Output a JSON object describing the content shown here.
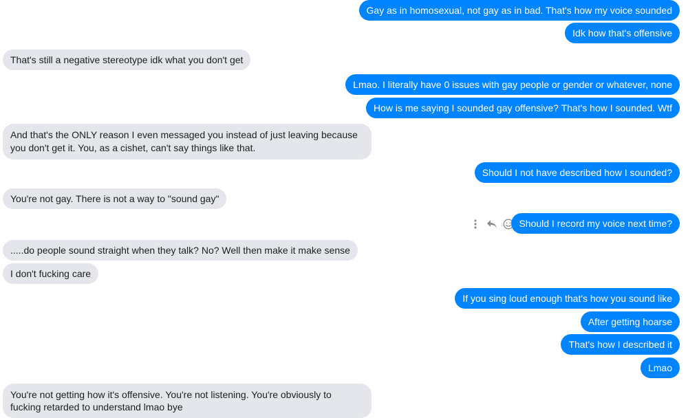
{
  "messages": [
    {
      "dir": "out",
      "text": "Gay as in homosexual, not gay as in bad. That's how my voice sounded"
    },
    {
      "dir": "out",
      "text": "Idk how that's offensive"
    },
    {
      "dir": "in",
      "text": "That's still a negative stereotype idk what you don't get"
    },
    {
      "dir": "out",
      "text": "Lmao. I literally have 0 issues with gay people or gender or whatever, none"
    },
    {
      "dir": "out",
      "text": "How is me saying I sounded gay offensive? That's how I sounded. Wtf"
    },
    {
      "dir": "in",
      "text": "And that's the ONLY reason I even messaged you instead of just leaving because you don't get it. You, as a cishet, can't say things like that."
    },
    {
      "dir": "out",
      "text": "Should I not have described how I sounded?"
    },
    {
      "dir": "in",
      "text": "You're not gay. There is not a way to \"sound gay\""
    },
    {
      "dir": "out",
      "text": "Should I record my voice next time?"
    },
    {
      "dir": "in",
      "text": ".....do people sound straight when they talk? No? Well then make it make sense"
    },
    {
      "dir": "in",
      "text": "I don't fucking care"
    },
    {
      "dir": "out",
      "text": "If you sing loud enough that's how you sound like"
    },
    {
      "dir": "out",
      "text": "After getting hoarse"
    },
    {
      "dir": "out",
      "text": "That's how I described it"
    },
    {
      "dir": "out",
      "text": "Lmao"
    },
    {
      "dir": "in",
      "text": "You're not getting how it's offensive. You're not listening. You're obviously to fucking retarded to understand lmao bye"
    }
  ],
  "hover_actions": {
    "icons": [
      "more-options-icon",
      "reply-icon",
      "react-icon"
    ]
  },
  "colors": {
    "outgoing_bubble": "#0084ff",
    "incoming_bubble": "#e4e6eb",
    "icon_gray": "#8a8d91"
  }
}
